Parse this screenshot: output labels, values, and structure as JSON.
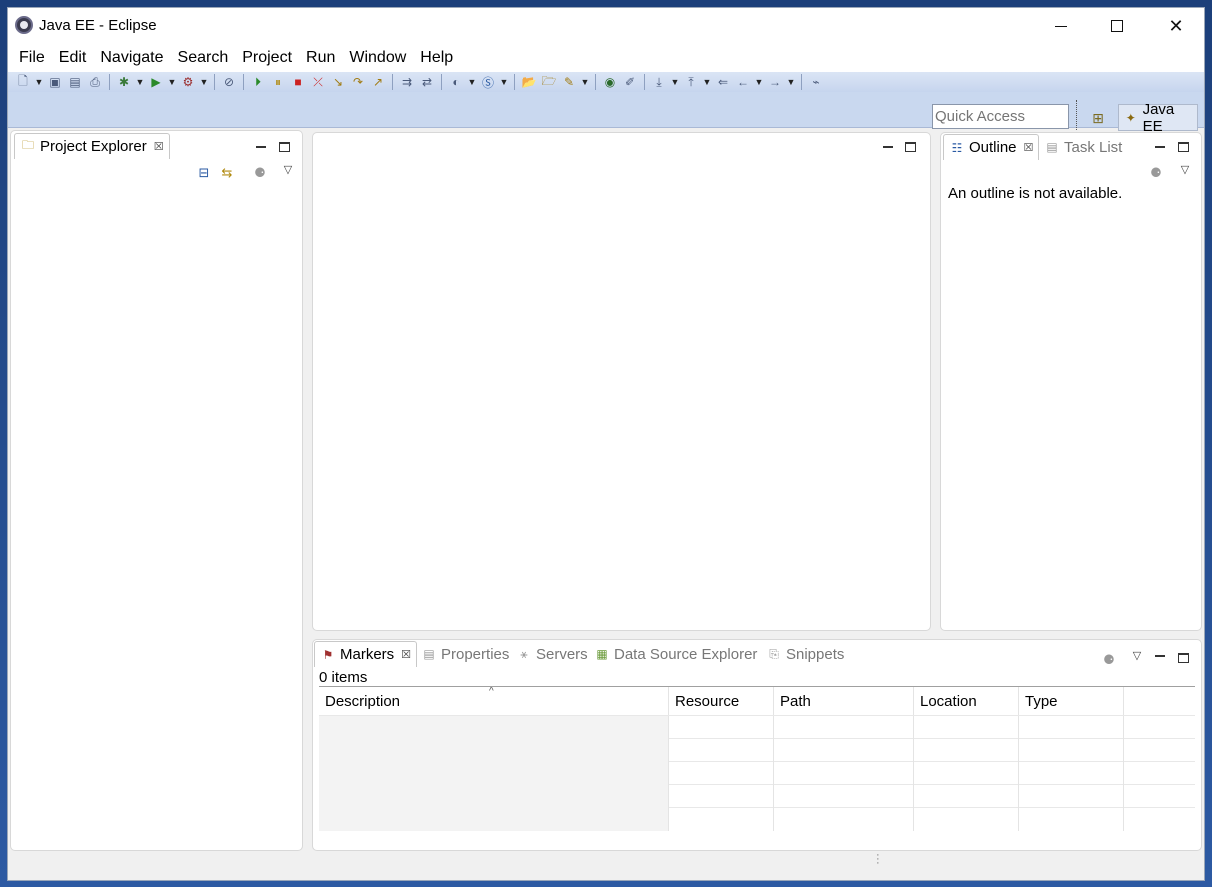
{
  "window": {
    "title": "Java EE - Eclipse"
  },
  "menu": [
    "File",
    "Edit",
    "Navigate",
    "Search",
    "Project",
    "Run",
    "Window",
    "Help"
  ],
  "toolbar": {
    "quick_access_placeholder": "Quick Access",
    "perspective_label": "Java EE"
  },
  "project_explorer": {
    "tab_label": "Project Explorer"
  },
  "outline": {
    "tab_label": "Outline",
    "task_list_label": "Task List",
    "message": "An outline is not available."
  },
  "bottom": {
    "tabs": {
      "markers": "Markers",
      "properties": "Properties",
      "servers": "Servers",
      "data_source": "Data Source Explorer",
      "snippets": "Snippets"
    },
    "items_count": "0 items",
    "columns": [
      "Description",
      "Resource",
      "Path",
      "Location",
      "Type"
    ]
  },
  "colors": {
    "toolbar_bg": "#c9d8ef",
    "accent": "#2d5aa3"
  },
  "icons": [
    "eclipse-icon",
    "folder-icon",
    "outline-icon",
    "task-list-icon",
    "markers-icon",
    "properties-icon",
    "servers-icon",
    "data-source-icon",
    "snippets-icon"
  ]
}
